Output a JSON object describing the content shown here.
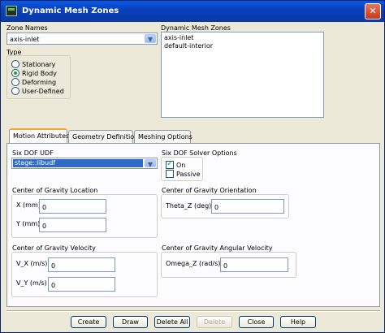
{
  "window": {
    "title": "Dynamic Mesh Zones",
    "close_glyph": "✕"
  },
  "zone_names": {
    "label": "Zone Names",
    "selected": "axis-inlet",
    "arrow": "▼"
  },
  "type_group": {
    "label": "Type",
    "options": [
      {
        "label": "Stationary",
        "selected": false
      },
      {
        "label": "Rigid Body",
        "selected": true
      },
      {
        "label": "Deforming",
        "selected": false
      },
      {
        "label": "User-Defined",
        "selected": false
      }
    ]
  },
  "dynamic_mesh_zones": {
    "label": "Dynamic Mesh Zones",
    "items": [
      "axis-inlet",
      "default-interior"
    ]
  },
  "tabs": [
    {
      "label": "Motion Attributes",
      "active": true
    },
    {
      "label": "Geometry Definition",
      "active": false
    },
    {
      "label": "Meshing Options",
      "active": false
    }
  ],
  "six_dof_udf": {
    "label": "Six DOF UDF",
    "selected": "stage::libudf",
    "arrow": "▼"
  },
  "six_dof_solver": {
    "label": "Six DOF Solver Options",
    "on": {
      "label": "On",
      "checked": true
    },
    "passive": {
      "label": "Passive",
      "checked": false
    }
  },
  "cg_location": {
    "label": "Center of Gravity Location",
    "x": {
      "label": "X (mm)",
      "value": "0"
    },
    "y": {
      "label": "Y (mm)",
      "value": "0"
    }
  },
  "cg_orientation": {
    "label": "Center of Gravity Orientation",
    "theta_z": {
      "label": "Theta_Z (deg)",
      "value": "0"
    }
  },
  "cg_velocity": {
    "label": "Center of Gravity Velocity",
    "vx": {
      "label": "V_X (m/s)",
      "value": "0"
    },
    "vy": {
      "label": "V_Y (m/s)",
      "value": "0"
    }
  },
  "cg_angular_velocity": {
    "label": "Center of Gravity Angular Velocity",
    "omega_z": {
      "label": "Omega_Z (rad/s)",
      "value": "0"
    }
  },
  "buttons": {
    "create": "Create",
    "draw": "Draw",
    "delete_all": "Delete All",
    "delete": "Delete",
    "close": "Close",
    "help": "Help"
  },
  "colors": {
    "titlebar": "#0a3fb8",
    "dialog_bg": "#ece9d8",
    "selection": "#316ac5",
    "active_tab_accent": "#f7a435",
    "radio_check_mark": "#21a121"
  }
}
